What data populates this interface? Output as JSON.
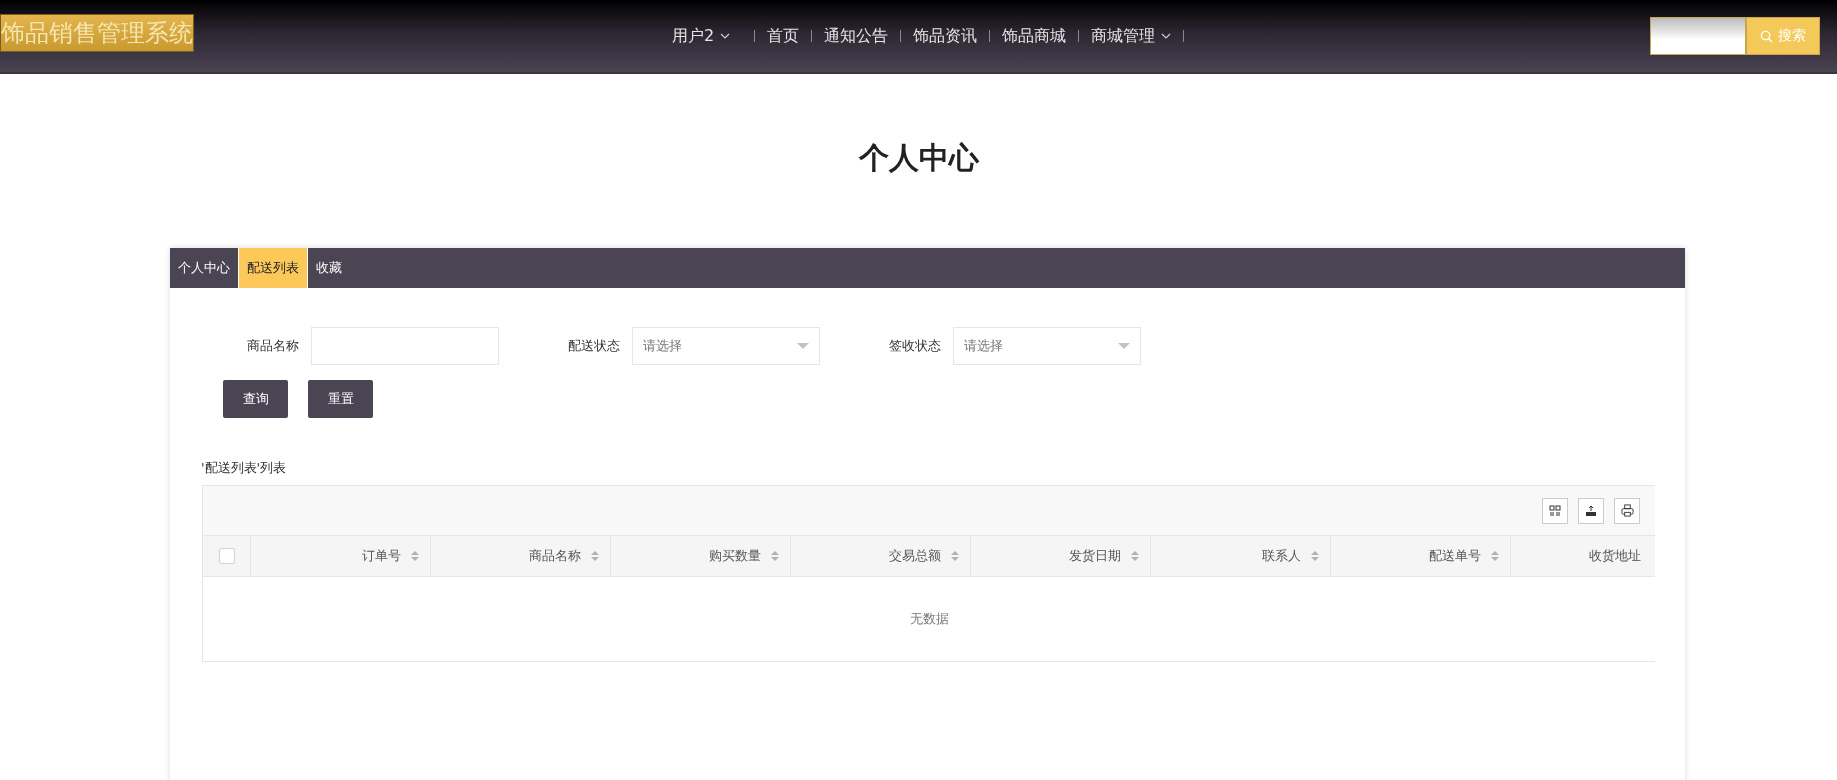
{
  "header": {
    "logo": "饰品销售管理系统",
    "nav": [
      {
        "label": "用户2",
        "dropdown": true
      },
      {
        "label": "首页",
        "dropdown": false
      },
      {
        "label": "通知公告",
        "dropdown": false
      },
      {
        "label": "饰品资讯",
        "dropdown": false
      },
      {
        "label": "饰品商城",
        "dropdown": false
      },
      {
        "label": "商城管理",
        "dropdown": true
      }
    ],
    "search_button": "搜索"
  },
  "page_title": "个人中心",
  "tabs": [
    {
      "label": "个人中心",
      "selected": false
    },
    {
      "label": "配送列表",
      "selected": true
    },
    {
      "label": "收藏",
      "selected": false
    }
  ],
  "filters": [
    {
      "label": "商品名称",
      "kind": "text"
    },
    {
      "label": "配送状态",
      "kind": "select",
      "placeholder": "请选择"
    },
    {
      "label": "签收状态",
      "kind": "select",
      "placeholder": "请选择"
    }
  ],
  "buttons": [
    "查询",
    "重置"
  ],
  "table": {
    "caption": "'配送列表'列表",
    "columns": [
      "订单号",
      "商品名称",
      "购买数量",
      "交易总额",
      "发货日期",
      "联系人",
      "配送单号",
      "收货地址"
    ],
    "select_all_checked": false,
    "empty_text": "无数据"
  }
}
